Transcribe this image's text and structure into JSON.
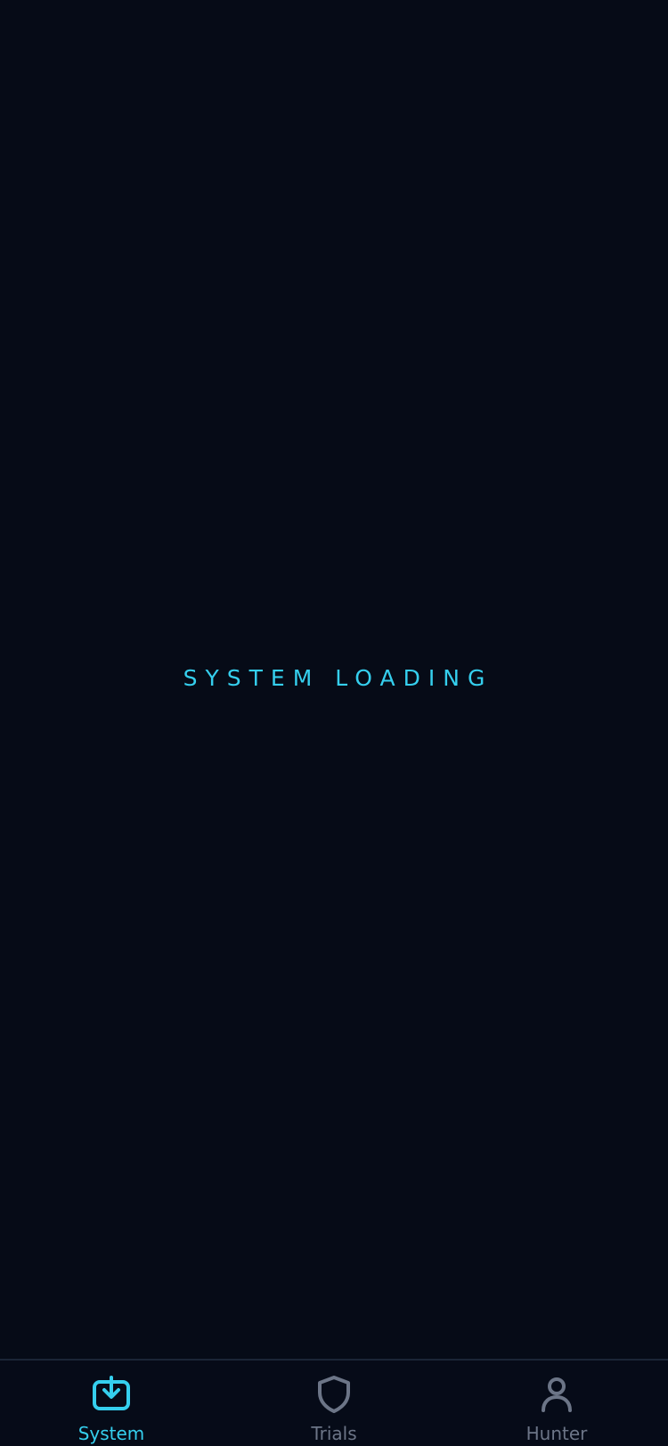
{
  "colors": {
    "background": "#060b17",
    "accent": "#35cfee",
    "inactive": "#6c7587",
    "tabbar_border": "#1b2536"
  },
  "loading": {
    "text": "SYSTEM LOADING"
  },
  "tabbar": {
    "tabs": [
      {
        "label": "System",
        "icon": "download-tray-icon",
        "active": true
      },
      {
        "label": "Trials",
        "icon": "shield-icon",
        "active": false
      },
      {
        "label": "Hunter",
        "icon": "user-icon",
        "active": false
      }
    ]
  }
}
